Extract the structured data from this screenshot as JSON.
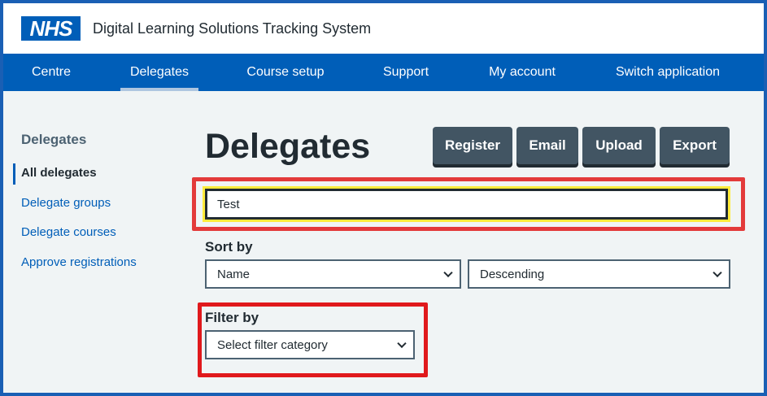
{
  "header": {
    "logo_text": "NHS",
    "service_name": "Digital Learning Solutions Tracking System"
  },
  "nav": {
    "items": [
      {
        "label": "Centre"
      },
      {
        "label": "Delegates"
      },
      {
        "label": "Course setup"
      },
      {
        "label": "Support"
      },
      {
        "label": "My account"
      },
      {
        "label": "Switch application"
      }
    ],
    "active": "Delegates"
  },
  "sidebar": {
    "title": "Delegates",
    "items": [
      {
        "label": "All delegates"
      },
      {
        "label": "Delegate groups"
      },
      {
        "label": "Delegate courses"
      },
      {
        "label": "Approve registrations"
      }
    ],
    "current": "All delegates"
  },
  "main": {
    "title": "Delegates",
    "buttons": {
      "register": "Register",
      "email": "Email",
      "upload": "Upload",
      "export": "Export"
    },
    "search": {
      "value": "Test"
    },
    "sort": {
      "label": "Sort by",
      "field": "Name",
      "direction": "Descending"
    },
    "filter": {
      "label": "Filter by",
      "category": "Select filter category"
    }
  },
  "colors": {
    "brand": "#005eb8",
    "highlight": "#e33a3a",
    "focus": "#ffeb3b"
  }
}
